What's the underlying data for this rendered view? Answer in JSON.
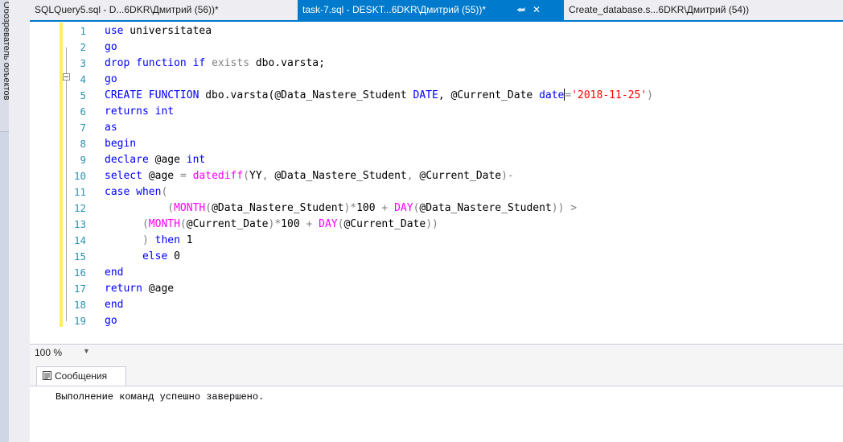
{
  "sidebar": {
    "label": "Обозреватель объектов"
  },
  "tabs": [
    {
      "label": "SQLQuery5.sql - D...6DKR\\Дмитрий (56))*",
      "active": false
    },
    {
      "label": "task-7.sql - DESKT...6DKR\\Дмитрий (55))*",
      "active": true
    },
    {
      "label": "Create_database.s...6DKR\\Дмитрий (54))",
      "active": false
    }
  ],
  "tab_icons": {
    "pin": "pin-icon",
    "close": "close-icon"
  },
  "editor": {
    "line_numbers": [
      "1",
      "2",
      "3",
      "4",
      "5",
      "6",
      "7",
      "8",
      "9",
      "10",
      "11",
      "12",
      "13",
      "14",
      "15",
      "16",
      "17",
      "18",
      "19"
    ]
  },
  "zoom": {
    "value": "100 %"
  },
  "results": {
    "tab_label": "Сообщения",
    "message": "Выполнение команд успешно завершено."
  },
  "colors": {
    "accent": "#007acc",
    "keyword": "#0000ff",
    "function": "#ff00ff",
    "string": "#ff0000",
    "line_number": "#2b91af"
  }
}
